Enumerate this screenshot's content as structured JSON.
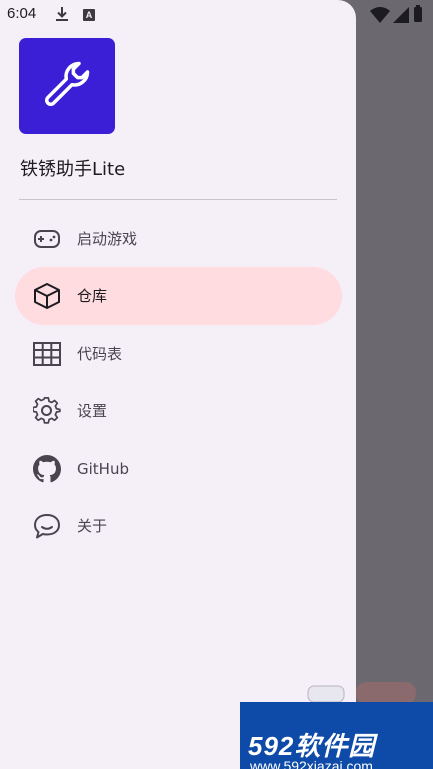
{
  "status_bar": {
    "time": "6:04",
    "download_icon": "download-icon",
    "notification_icon": "A",
    "wifi_icon": "wifi-icon",
    "signal_icon": "cell-signal-icon",
    "battery_icon": "battery-icon"
  },
  "drawer": {
    "app_title": "铁锈助手Lite",
    "logo_icon": "wrench-icon",
    "items": [
      {
        "label": "启动游戏",
        "icon": "gamepad-icon",
        "active": false
      },
      {
        "label": "仓库",
        "icon": "cube-icon",
        "active": true
      },
      {
        "label": "代码表",
        "icon": "table-icon",
        "active": false
      },
      {
        "label": "设置",
        "icon": "gear-icon",
        "active": false
      },
      {
        "label": "GitHub",
        "icon": "github-icon",
        "active": false
      },
      {
        "label": "关于",
        "icon": "chat-bubble-icon",
        "active": false
      }
    ]
  },
  "colors": {
    "scrim": "#6b6870",
    "drawer_bg": "#f5f0f7",
    "active_item_bg": "#ffdcdf",
    "logo_bg": "#3a1fd6"
  },
  "watermark": {
    "brand": "592软件园",
    "url": "www.592xiazai.com"
  }
}
